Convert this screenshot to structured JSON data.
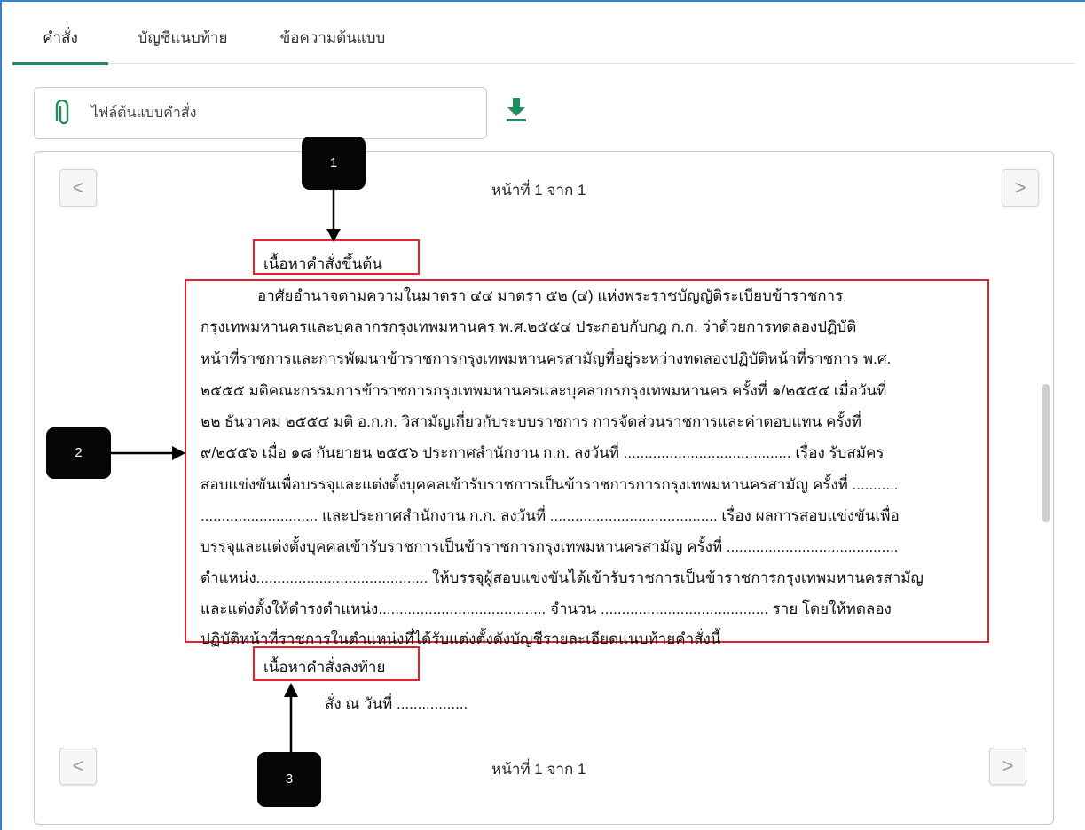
{
  "tabs": [
    "คำสั่ง",
    "บัญชีแนบท้าย",
    "ข้อความต้นแบบ"
  ],
  "file": {
    "label": "ไฟล์ต้นแบบคำสั่ง",
    "icon": "paperclip-icon",
    "download_icon": "download-icon",
    "accent": "#1e8e5a"
  },
  "viewer": {
    "page_info_top": "หน้าที่ 1 จาก 1",
    "page_info_bottom": "หน้าที่ 1 จาก 1",
    "prev_symbol": "<",
    "next_symbol": ">"
  },
  "document": {
    "header_label": "เนื้อหาคำสั่งขึ้นต้น",
    "body_lines": [
      "อาศัยอำนาจตามความในมาตรา ๔๔ มาตรา ๕๒ (๔) แห่งพระราชบัญญัติระเบียบข้าราชการ",
      "กรุงเทพมหานครและบุคลากรกรุงเทพมหานคร พ.ศ.๒๕๕๔  ประกอบกับกฎ ก.ก. ว่าด้วยการทดลองปฏิบัติ",
      "หน้าที่ราชการและการพัฒนาข้าราชการกรุงเทพมหานครสามัญที่อยู่ระหว่างทดลองปฏิบัติหน้าที่ราชการ พ.ศ.",
      "๒๕๕๕ มติคณะกรรมการข้าราชการกรุงเทพมหานครและบุคลากรกรุงเทพมหานคร ครั้งที่ ๑/๒๕๕๔ เมื่อวันที่",
      "๒๒ ธันวาคม ๒๕๕๔ มติ อ.ก.ก. วิสามัญเกี่ยวกับระบบราชการ การจัดส่วนราชการและค่าตอบแทน ครั้งที่",
      "๙/๒๕๕๖ เมื่อ ๑๘ กันยายน ๒๕๕๖ ประกาศสำนักงาน ก.ก. ลงวันที่ ........................................ เรื่อง รับสมัคร",
      "สอบแข่งขันเพื่อบรรจุและแต่งตั้งบุคคลเข้ารับราชการเป็นข้าราชการการกรุงเทพมหานครสามัญ ครั้งที่ ...........",
      "............................ และประกาศสำนักงาน ก.ก. ลงวันที่ ........................................ เรื่อง ผลการสอบแข่งขันเพื่อ",
      "บรรจุและแต่งตั้งบุคคลเข้ารับราชการเป็นข้าราชการกรุงเทพมหานครสามัญ ครั้งที่ .........................................",
      "ตำแหน่ง......................................... ให้บรรจุผู้สอบแข่งขันได้เข้ารับราชการเป็นข้าราชการกรุงเทพมหานครสามัญ",
      "และแต่งตั้งให้ดำรงตำแหน่ง........................................ จำนวน ........................................ ราย โดยให้ทดลอง",
      "ปฏิบัติหน้าที่ราชการในตำแหน่งที่ได้รับแต่งตั้งดังบัญชีรายละเอียดแนบท้ายคำสั่งนี้"
    ],
    "footer_label": "เนื้อหาคำสั่งลงท้าย",
    "sign_line": "สั่ง ณ วันที่ ................."
  },
  "callouts": [
    "1",
    "2",
    "3"
  ],
  "colors": {
    "annotation_red": "#e3222b",
    "callout_bg": "#050505",
    "frame_blue": "#3a7fd0"
  }
}
